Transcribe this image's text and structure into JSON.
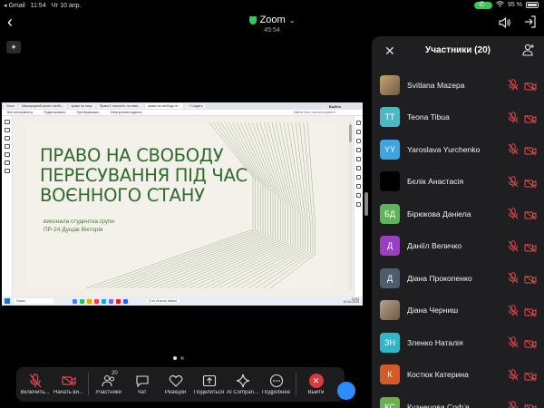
{
  "status_bar": {
    "back_app": "◂ Gmail",
    "time": "11:54",
    "date": "Чт 10 апр.",
    "battery": "95 %"
  },
  "header": {
    "title": "Zoom",
    "timer": "45:54"
  },
  "shared_screen": {
    "tabs": [
      "Zoom",
      "Міжнародний захист свобо...",
      "право на тему",
      "Права 1 поколінн, по неве...",
      "право на свободу пе...",
      "+ Создать"
    ],
    "exit_label": "Выйти",
    "toolbar": [
      "Все инструменты",
      "Редактировать",
      "Преобразовать",
      "Электронная подпись"
    ],
    "find_placeholder": "Найти текст или инструмент",
    "slide": {
      "title_lines": [
        "ПРАВО НА СВОБОДУ",
        "ПЕРЕСУВАННЯ ПІД ЧАС",
        "ВОЄННОГО СТАНУ"
      ],
      "subtitle_lines": [
        "виконала студентка групи",
        "ПР-24 Дущак Вікторія"
      ]
    },
    "taskbar": {
      "search": "Поиск",
      "notification": "2 on of snow ahead",
      "clock_time": "11:54",
      "clock_date": "10.04.2025"
    }
  },
  "toolbar": {
    "items": [
      {
        "label": "Включить...",
        "icon": "mic-muted-icon"
      },
      {
        "label": "Начать ви...",
        "icon": "camera-off-icon"
      },
      {
        "label": "Участники",
        "icon": "participants-icon",
        "count": "20"
      },
      {
        "label": "Чат",
        "icon": "chat-icon"
      },
      {
        "label": "Реакции",
        "icon": "heart-icon"
      },
      {
        "label": "Поделиться",
        "icon": "share-icon"
      },
      {
        "label": "AI Compan...",
        "icon": "sparkle-icon"
      },
      {
        "label": "Подробнее",
        "icon": "more-icon"
      },
      {
        "label": "Выйти",
        "icon": "leave-icon"
      }
    ]
  },
  "panel": {
    "title": "Участники (20)",
    "participants": [
      {
        "name": "Svitlana Mazepa",
        "initials": "",
        "color": "#c9a56c",
        "photo": true
      },
      {
        "name": "Teona Tibua",
        "initials": "TT",
        "color": "#4bb8c4"
      },
      {
        "name": "Yaroslava Yurchenko",
        "initials": "YY",
        "color": "#3ea5e0"
      },
      {
        "name": "Бєлік Анастасія",
        "initials": "",
        "color": "#000000"
      },
      {
        "name": "Бірюкова Даніела",
        "initials": "БД",
        "color": "#5fb35b"
      },
      {
        "name": "Даніїл Величко",
        "initials": "Д",
        "color": "#9b3fc2"
      },
      {
        "name": "Діана Прокопенко",
        "initials": "Д",
        "color": "#4c5d6e"
      },
      {
        "name": "Діана Черниш",
        "initials": "",
        "color": "#b7a18b",
        "photo": true
      },
      {
        "name": "Зленко Наталія",
        "initials": "ЗН",
        "color": "#33b5c9"
      },
      {
        "name": "Костюк Катерина",
        "initials": "К",
        "color": "#d45a2a"
      },
      {
        "name": "Кузнецова Софʼя",
        "initials": "КС",
        "color": "#6ab04c"
      }
    ]
  },
  "colors": {
    "accent": "#2d8cff",
    "muted_red": "#e5484d",
    "slide_green": "#2e6b2c",
    "leave_red": "#d83b3b"
  }
}
